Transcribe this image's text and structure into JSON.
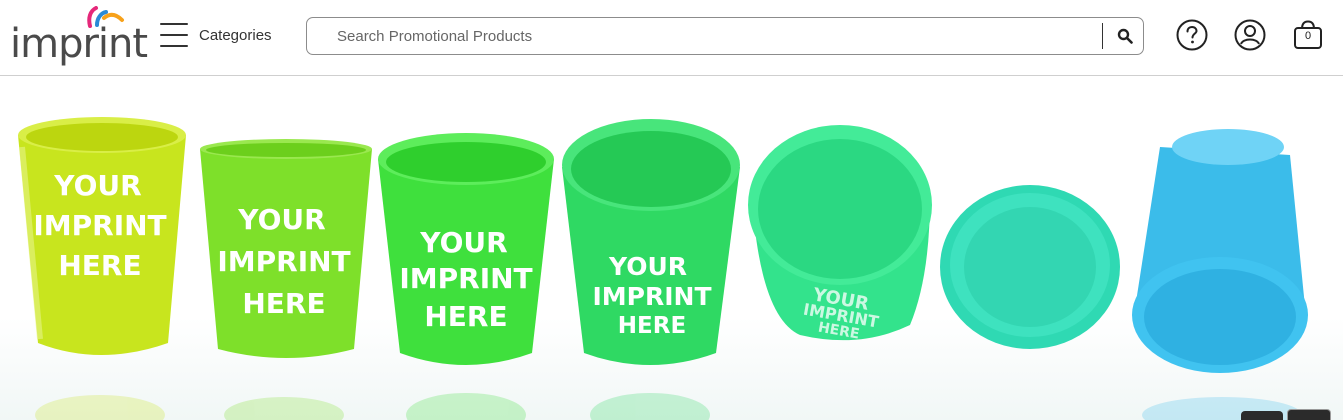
{
  "header": {
    "logo_text": "imprint",
    "menu_label": "Categories",
    "search": {
      "placeholder": "Search Promotional Products",
      "value": ""
    },
    "icons": [
      "help-icon",
      "account-icon",
      "cart-icon"
    ],
    "cart_count": "0"
  },
  "hero": {
    "cup_imprint_lines": [
      "YOUR",
      "IMPRINT",
      "HERE"
    ],
    "cup_colors": [
      "#c8e51e",
      "#7ee02a",
      "#3fe03d",
      "#2fd963",
      "#33e38c",
      "#2fd9b3",
      "#3bbcea"
    ]
  },
  "colors": {
    "border": "#cfcfcf",
    "text": "#333333",
    "logo_text": "#4a4a4a"
  }
}
